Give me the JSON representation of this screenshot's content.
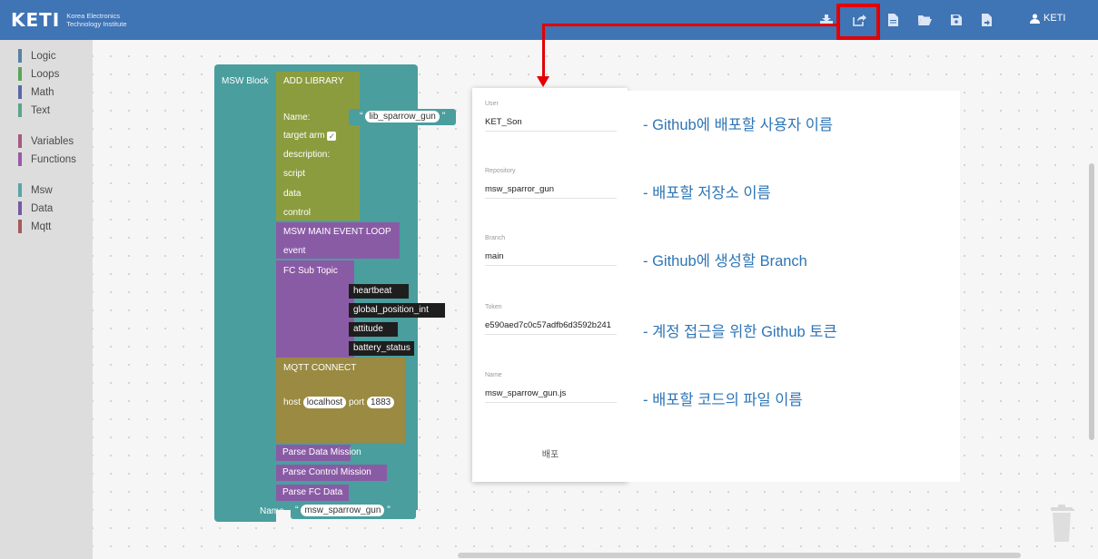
{
  "header": {
    "logo_mark": "KETI",
    "logo_sub_line1": "Korea Electronics",
    "logo_sub_line2": "Technology Institute",
    "user_name": "KETI",
    "buttons": [
      {
        "id": "download",
        "icon": "download-icon"
      },
      {
        "id": "deploy",
        "icon": "share-export-icon"
      },
      {
        "id": "new-file",
        "icon": "file-icon"
      },
      {
        "id": "open-folder",
        "icon": "folder-open-icon"
      },
      {
        "id": "save",
        "icon": "save-icon"
      },
      {
        "id": "export-file",
        "icon": "file-export-icon"
      }
    ],
    "header_color": "#3f74b5",
    "highlight_color": "#e30000"
  },
  "toolbox": {
    "items": [
      {
        "label": "Logic",
        "color": "#5b80a5"
      },
      {
        "label": "Loops",
        "color": "#5ba55b"
      },
      {
        "label": "Math",
        "color": "#5b67a5"
      },
      {
        "label": "Text",
        "color": "#5ba58c"
      },
      {
        "label": "Variables",
        "color": "#a55b80"
      },
      {
        "label": "Functions",
        "color": "#995ba5"
      },
      {
        "label": "Msw",
        "color": "#5ba5a5"
      },
      {
        "label": "Data",
        "color": "#745ba5"
      },
      {
        "label": "Mqtt",
        "color": "#a55b5b"
      }
    ]
  },
  "blocks": {
    "msw_block": "MSW Block",
    "add_library": "ADD LIBRARY",
    "name_label": "Name:",
    "lib_name": "lib_sparrow_gun",
    "target_label": "target  arm",
    "description_label": "description:",
    "script_label": "script",
    "data_label": "data",
    "control_label": "control",
    "main_loop": "MSW MAIN EVENT LOOP",
    "event_label": "event",
    "fc_sub_topic": "FC Sub Topic",
    "topics": [
      "heartbeat",
      "global_position_int",
      "attitude",
      "battery_status"
    ],
    "mqtt_connect": "MQTT CONNECT",
    "host_label": "host",
    "host_value": "localhost",
    "port_label": "port",
    "port_value": "1883",
    "parse_data_mission": "Parse Data Mission",
    "parse_control_mission": "Parse Control Mission",
    "parse_fc_data": "Parse FC Data",
    "bottom_name_label": "Name",
    "bottom_name_value": "msw_sparrow_gun",
    "quote_open": "“",
    "quote_close": "”"
  },
  "dialog": {
    "fields": [
      {
        "label": "User",
        "value": "KET_Son"
      },
      {
        "label": "Repository",
        "value": "msw_sparror_gun"
      },
      {
        "label": "Branch",
        "value": "main"
      },
      {
        "label": "Token",
        "value": "e590aed7c0c57adfb6d3592b241"
      },
      {
        "label": "Name",
        "value": "msw_sparrow_gun.js"
      }
    ],
    "deploy_button": "배포"
  },
  "annotations": [
    "- Github에 배포할 사용자 이름",
    "- 배포할 저장소 이름",
    "- Github에 생성할 Branch",
    "- 계정 접근을 위한 Github 토큰",
    "- 배포할 코드의 파일 이름"
  ]
}
